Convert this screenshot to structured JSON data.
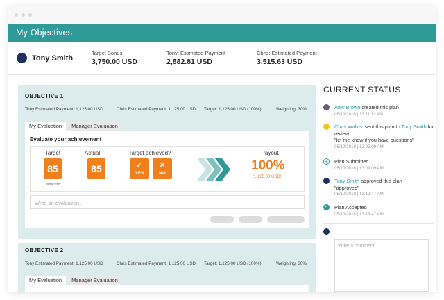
{
  "header": {
    "title": "My Objectives"
  },
  "summary": {
    "user_name": "Tony Smith",
    "stats": [
      {
        "label": "Target Bonus",
        "value": "3,750.00 USD"
      },
      {
        "label": "Tony: Estimated Payment",
        "value": "2,882.81 USD"
      },
      {
        "label": "Chris: Estimated Payment",
        "value": "3,515.63 USD"
      }
    ]
  },
  "objective1": {
    "title": "OBJECTIVE 1",
    "meta": [
      "Tony Estimated Payment: 1,125.00 USD",
      "Chris Estimated Payment: 1,125.00 USD",
      "Target: 1,125.00 USD (100%)",
      "Weighting: 30%"
    ],
    "tabs": [
      "My Evaluation",
      "Manager Evaluation"
    ],
    "panel_title": "Evaluate your achievement",
    "labels": {
      "target": "Target",
      "actual": "Actual",
      "achieved": "Target achieved?",
      "payout": "Payout"
    },
    "target_value": "85",
    "target_unit": "PERCENT",
    "actual_value": "85",
    "yes_label": "YES",
    "no_label": "NO",
    "payout_value": "100%",
    "payout_amount": "(1,125.00 USD)",
    "evaluation_placeholder": "Write an evaluation..."
  },
  "objective2": {
    "title": "OBJECTIVE 2",
    "meta": [
      "Tony Estimated Payment: 1,125.00 USD",
      "Chris Estimated Payment: 1,125.00 USD",
      "Target: 1,125.00 USD (100%)",
      "Weighting: 30%"
    ],
    "tabs": [
      "My Evaluation",
      "Manager Evaluation"
    ]
  },
  "status": {
    "title": "CURRENT STATUS",
    "events": [
      {
        "who": "Amy Brown",
        "text": " created this plan",
        "time": "05/10/2018 | 13:11:13 AM"
      },
      {
        "who": "Chris Walker",
        "text": " sent this plan to ",
        "who2": "Tony Smith",
        "text2": " for review:",
        "quote": "\"let me know if you have questions\"",
        "time": "05/10/2018 | 13:05:09 AM"
      },
      {
        "text": "Plan Submitted",
        "time": "05/10/2018 | 13:09:09 AM"
      },
      {
        "who": "Tony Smith",
        "text": " approved this plan",
        "quote": "\"approved\"",
        "time": "05/10/2018 | 13:12:47 AM"
      },
      {
        "text": "Plan Accepted",
        "time": "05/10/2018 | 13:13:47 AM"
      }
    ],
    "comment_placeholder": "Write a comment..."
  },
  "colors": {
    "teal": "#2f9a98",
    "orange": "#f07f1e",
    "navy": "#1d2f5e",
    "panel_bg": "#dcecec"
  }
}
